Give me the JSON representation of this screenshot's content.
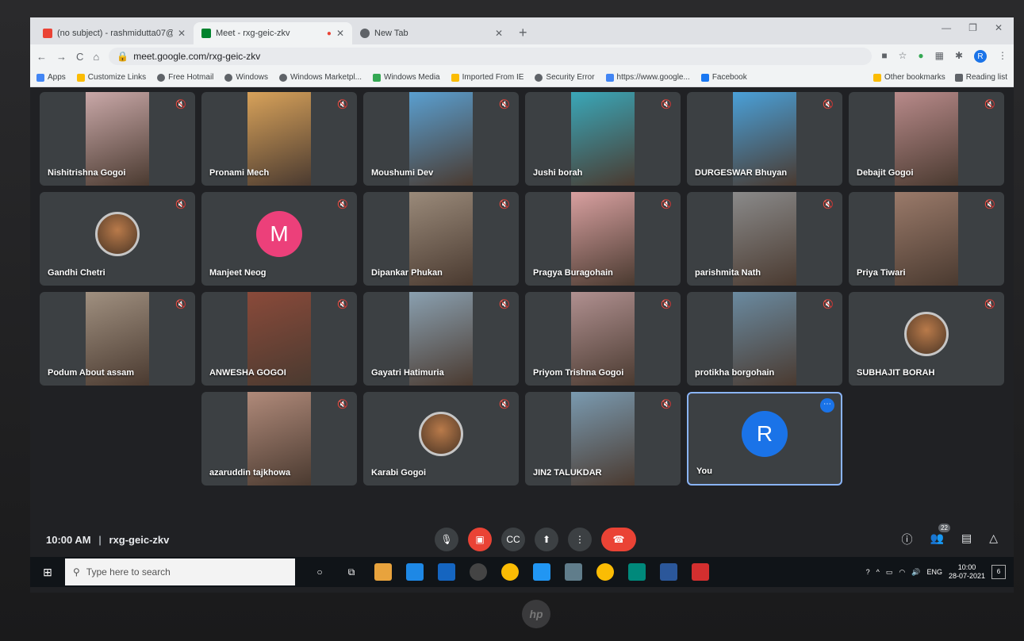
{
  "browser": {
    "tabs": [
      {
        "title": "(no subject) - rashmidutta07@g",
        "icon": "gmail-icon",
        "color": "#ea4335",
        "active": false
      },
      {
        "title": "Meet - rxg-geic-zkv",
        "icon": "meet-icon",
        "color": "#00832d",
        "active": true
      },
      {
        "title": "New Tab",
        "icon": "chrome-icon",
        "color": "#5f6368",
        "active": false
      }
    ],
    "url": "meet.google.com/rxg-geic-zkv",
    "profile_initial": "R"
  },
  "bookmarks": {
    "items": [
      {
        "label": "Apps",
        "color": "#4285f4"
      },
      {
        "label": "Customize Links",
        "color": "#fbbc04"
      },
      {
        "label": "Free Hotmail",
        "color": "#5f6368"
      },
      {
        "label": "Windows",
        "color": "#5f6368"
      },
      {
        "label": "Windows Marketpl...",
        "color": "#5f6368"
      },
      {
        "label": "Windows Media",
        "color": "#34a853"
      },
      {
        "label": "Imported From IE",
        "color": "#fbbc04"
      },
      {
        "label": "Security Error",
        "color": "#5f6368"
      },
      {
        "label": "https://www.google...",
        "color": "#4285f4"
      },
      {
        "label": "Facebook",
        "color": "#1877f2"
      }
    ],
    "other": "Other bookmarks",
    "reading": "Reading list"
  },
  "participants": [
    {
      "name": "Nishitrishna Gogoi",
      "type": "video",
      "color": "#c9a8a8"
    },
    {
      "name": "Pronami Mech",
      "type": "video",
      "color": "#d8a25a"
    },
    {
      "name": "Moushumi Dev",
      "type": "video",
      "color": "#5a9fd0"
    },
    {
      "name": "Jushi borah",
      "type": "video",
      "color": "#3aa7b8"
    },
    {
      "name": "DURGESWAR Bhuyan",
      "type": "video",
      "color": "#4aa0d8"
    },
    {
      "name": "Debajit Gogoi",
      "type": "video",
      "color": "#b88a8a"
    },
    {
      "name": "Gandhi Chetri",
      "type": "photo-avatar",
      "color": "#9c5a3a"
    },
    {
      "name": "Manjeet Neog",
      "type": "letter-avatar",
      "letter": "M",
      "color": "#ec407a"
    },
    {
      "name": "Dipankar Phukan",
      "type": "video",
      "color": "#9a8a7a"
    },
    {
      "name": "Pragya Buragohain",
      "type": "video",
      "color": "#d8a0a0"
    },
    {
      "name": "parishmita Nath",
      "type": "video",
      "color": "#8a8a8a"
    },
    {
      "name": "Priya Tiwari",
      "type": "video",
      "color": "#9a7a6a"
    },
    {
      "name": "Podum About assam",
      "type": "video",
      "color": "#a09080"
    },
    {
      "name": "ANWESHA GOGOI",
      "type": "video",
      "color": "#8a4a3a"
    },
    {
      "name": "Gayatri Hatimuria",
      "type": "video",
      "color": "#8aa0b0"
    },
    {
      "name": "Priyom Trishna Gogoi",
      "type": "video",
      "color": "#b09090"
    },
    {
      "name": "protikha borgohain",
      "type": "video",
      "color": "#6a8aa0"
    },
    {
      "name": "SUBHAJIT BORAH",
      "type": "photo-avatar",
      "color": "#5a6a7a"
    },
    {
      "name": "azaruddin tajkhowa",
      "type": "video",
      "color": "#b08a7a"
    },
    {
      "name": "Karabi Gogoi",
      "type": "photo-avatar",
      "color": "#8aa08a"
    },
    {
      "name": "JIN2 TALUKDAR",
      "type": "video",
      "color": "#7a9ab0"
    },
    {
      "name": "You",
      "type": "letter-avatar",
      "letter": "R",
      "color": "#1a73e8",
      "self": true
    }
  ],
  "meeting": {
    "time": "10:00 AM",
    "code": "rxg-geic-zkv",
    "participant_count": "22"
  },
  "taskbar": {
    "search_placeholder": "Type here to search",
    "language": "ENG",
    "time": "10:00",
    "date": "28-07-2021",
    "notifications": "6"
  }
}
